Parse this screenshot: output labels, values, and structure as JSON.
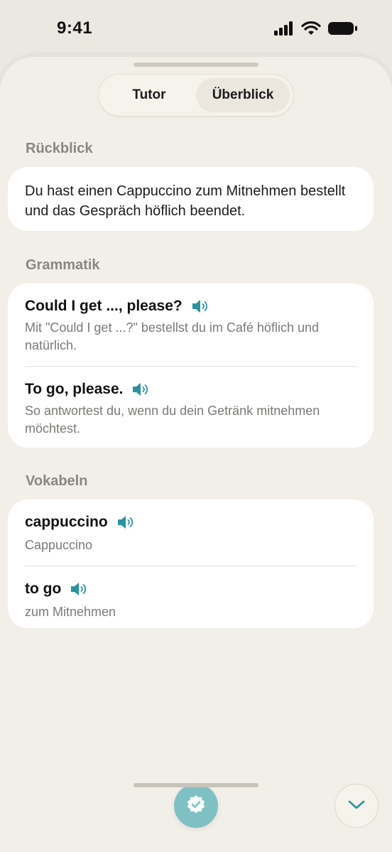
{
  "status": {
    "time": "9:41"
  },
  "tabs": [
    {
      "label": "Tutor",
      "active": false
    },
    {
      "label": "Überblick",
      "active": true
    }
  ],
  "review": {
    "heading": "Rückblick",
    "text": "Du hast einen Cappuccino zum Mitnehmen bestellt und das Gespräch höflich beendet."
  },
  "grammar": {
    "heading": "Grammatik",
    "items": [
      {
        "title": "Could I get ..., please?",
        "description": "Mit \"Could I get ...?\" bestellst du im Café höflich und natürlich."
      },
      {
        "title": "To go, please.",
        "description": "So antwortest du, wenn du dein Getränk mitnehmen möchtest."
      }
    ]
  },
  "vocab": {
    "heading": "Vokabeln",
    "items": [
      {
        "word": "cappuccino",
        "translation": "Cappuccino"
      },
      {
        "word": "to go",
        "translation": "zum Mitnehmen"
      }
    ]
  },
  "colors": {
    "accent": "#2a93a0",
    "accent_soft": "#7fc0c4",
    "background": "#f2efe8"
  },
  "icons": {
    "speaker": "speaker-icon",
    "complete": "check-badge-icon",
    "collapse": "chevron-down-icon"
  }
}
